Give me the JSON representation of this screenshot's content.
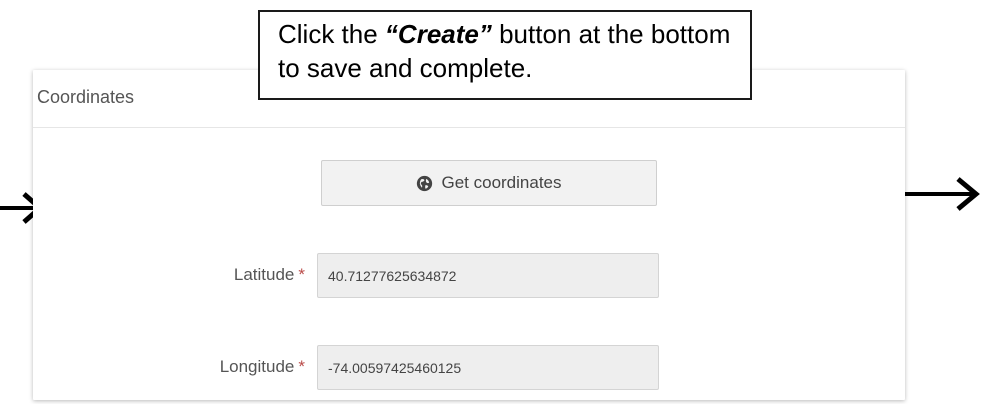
{
  "callout": {
    "pre": "Click the ",
    "emphasis": "“Create”",
    "post": " button at the bottom to save and complete."
  },
  "panel": {
    "title": "Coordinates"
  },
  "get_coordinates": {
    "label": "Get coordinates",
    "icon": "globe-icon"
  },
  "latitude": {
    "label": "Latitude",
    "required_marker": "*",
    "value": "40.71277625634872"
  },
  "longitude": {
    "label": "Longitude",
    "required_marker": "*",
    "value": "-74.00597425460125"
  },
  "colors": {
    "required": "#b94a48",
    "input_bg": "#eeeeee",
    "button_bg": "#f2f2f2"
  }
}
